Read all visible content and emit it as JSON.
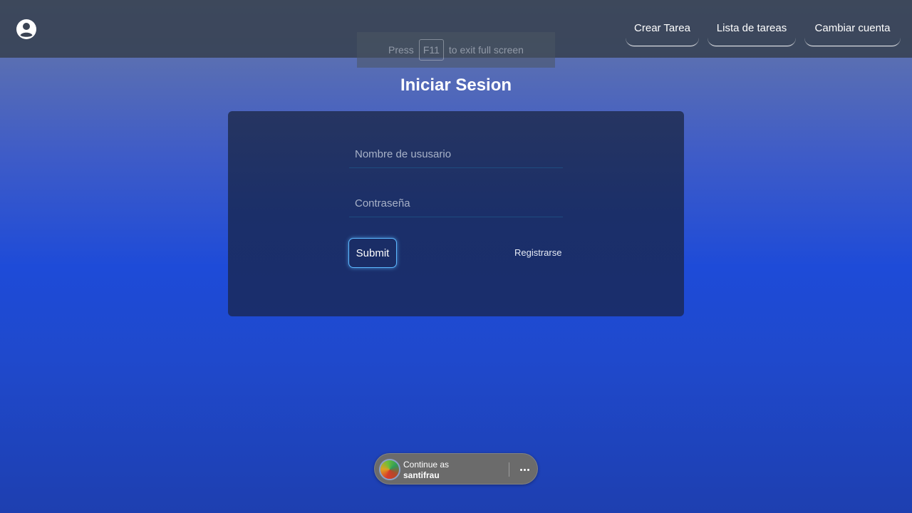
{
  "header": {
    "account_icon": "account-circle-icon",
    "nav": [
      {
        "label": "Crear Tarea"
      },
      {
        "label": "Lista de tareas"
      },
      {
        "label": "Cambiar cuenta"
      }
    ]
  },
  "fullscreen_hint": {
    "before": "Press",
    "key": "F11",
    "after": "to exit full screen"
  },
  "login": {
    "title": "Iniciar Sesion",
    "username_placeholder": "Nombre de ususario",
    "username_value": "",
    "password_placeholder": "Contraseña",
    "password_value": "",
    "submit_label": "Submit",
    "register_label": "Registrarse"
  },
  "one_tap": {
    "line1": "Continue as",
    "line2": "santifrau",
    "more_icon": "more-horizontal-icon"
  },
  "colors": {
    "accent_glow": "#5cb8ff",
    "card_bg": "#1b2f69",
    "topbar_bg": "#374151"
  }
}
